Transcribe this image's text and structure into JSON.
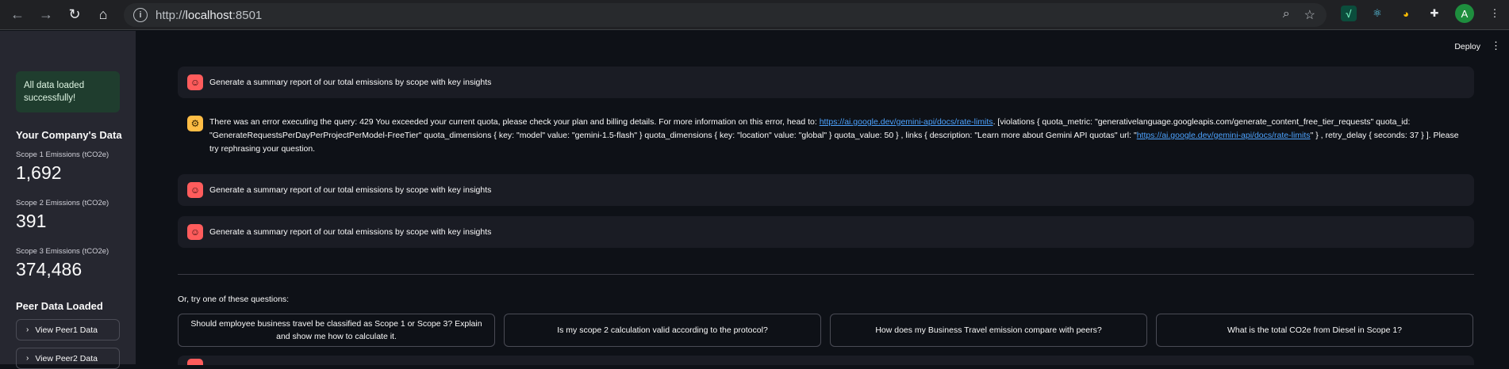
{
  "browser": {
    "url_scheme": "http://",
    "url_host": "localhost",
    "url_port": ":8501",
    "avatar_letter": "A"
  },
  "sidebar": {
    "success_message": "All data loaded successfully!",
    "company_title": "Your Company's Data",
    "metrics": [
      {
        "label": "Scope 1 Emissions (tCO2e)",
        "value": "1,692"
      },
      {
        "label": "Scope 2 Emissions (tCO2e)",
        "value": "391"
      },
      {
        "label": "Scope 3 Emissions (tCO2e)",
        "value": "374,486"
      }
    ],
    "peer_title": "Peer Data Loaded",
    "peer_buttons": [
      "View Peer1 Data",
      "View Peer2 Data"
    ]
  },
  "header": {
    "deploy_label": "Deploy",
    "menu_icon": "kebab-menu-icon"
  },
  "chat": {
    "messages": [
      {
        "role": "user",
        "text": "Generate a summary report of our total emissions by scope with key insights"
      },
      {
        "role": "assistant",
        "text_1": "There was an error executing the query: 429 You exceeded your current quota, please check your plan and billing details. For more information on this error, head to: ",
        "link_1": "https://ai.google.dev/gemini-api/docs/rate-limits",
        "text_2": ". [violations { quota_metric: \"generativelanguage.googleapis.com/generate_content_free_tier_requests\" quota_id: \"GenerateRequestsPerDayPerProjectPerModel-FreeTier\" quota_dimensions { key: \"model\" value: \"gemini-1.5-flash\" } quota_dimensions { key: \"location\" value: \"global\" } quota_value: 50 } , links { description: \"Learn more about Gemini API quotas\" url: \"",
        "link_2": "https://ai.google.dev/gemini-api/docs/rate-limits",
        "text_3": "\" } , retry_delay { seconds: 37 } ]. Please try rephrasing your question."
      },
      {
        "role": "user",
        "text": "Generate a summary report of our total emissions by scope with key insights"
      },
      {
        "role": "user",
        "text": "Generate a summary report of our total emissions by scope with key insights"
      }
    ]
  },
  "suggestions": {
    "label": "Or, try one of these questions:",
    "buttons": [
      "Should employee business travel be classified as Scope 1 or Scope 3? Explain and show me how to calculate it.",
      "Is my scope 2 calculation valid according to the protocol?",
      "How does my Business Travel emission compare with peers?",
      "What is the total CO2e from Diesel in Scope 1?"
    ]
  },
  "colors": {
    "background": "#0e1117",
    "sidebar": "#262730",
    "user_avatar": "#ff5c5c",
    "assistant_avatar": "#ffbd45",
    "link": "#4da3ff",
    "success_bg": "#1f3d2e"
  }
}
